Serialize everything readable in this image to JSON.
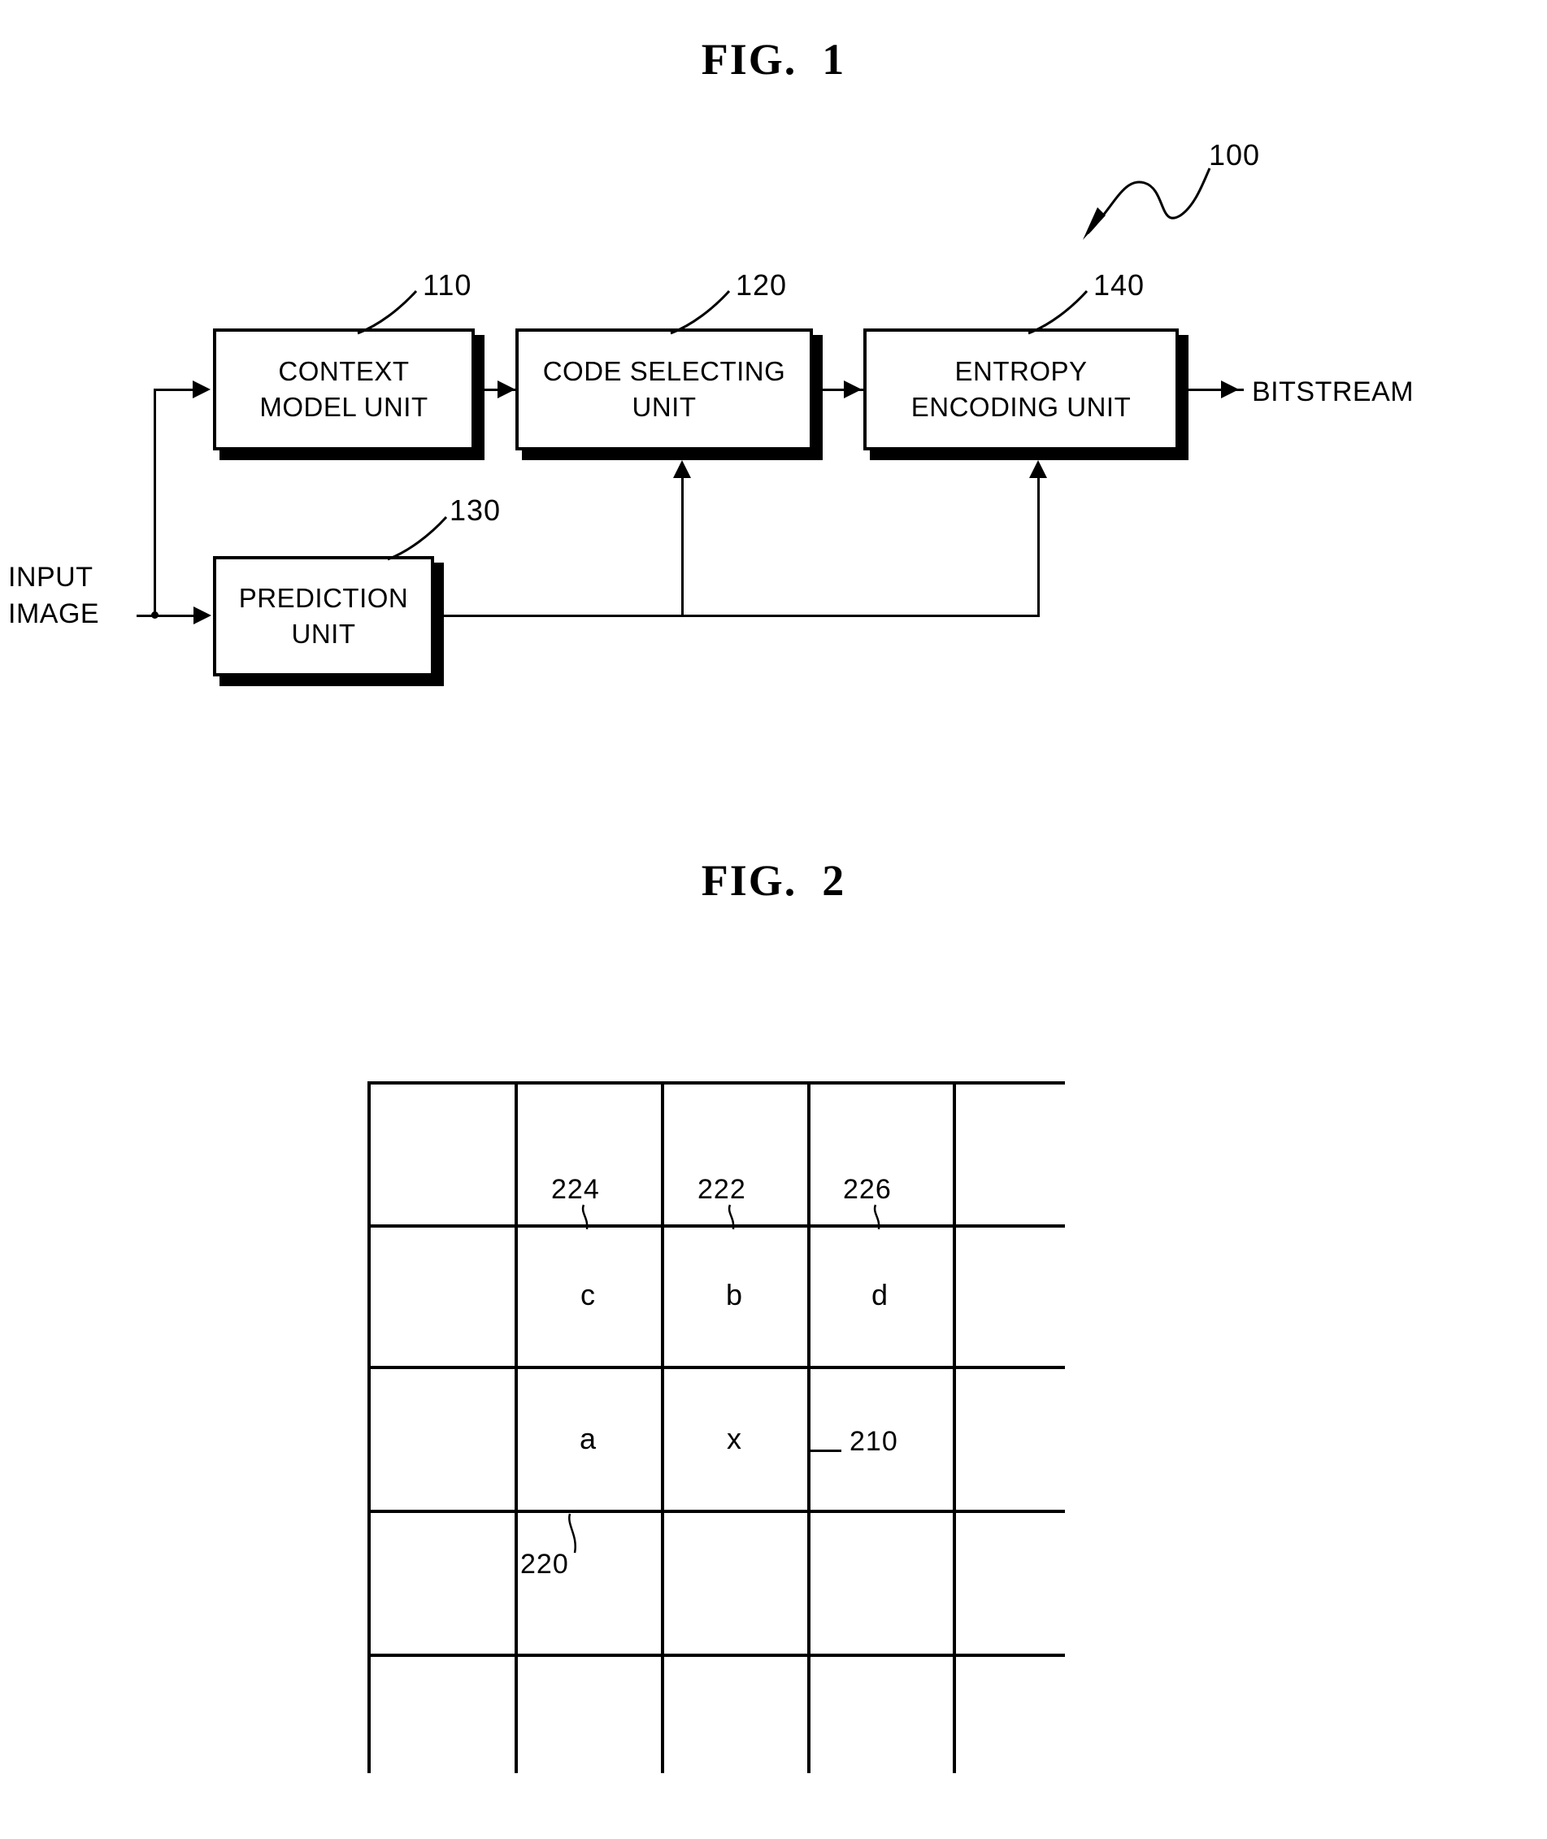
{
  "document": {
    "type": "patent-drawing-sheet",
    "background_color": "#ffffff",
    "line_color": "#000000"
  },
  "figure1": {
    "title": "FIG.  1",
    "system_ref": "100",
    "blocks": [
      {
        "id": "context-model-unit",
        "ref": "110",
        "label": "CONTEXT\nMODEL UNIT"
      },
      {
        "id": "code-selecting-unit",
        "ref": "120",
        "label": "CODE SELECTING\nUNIT"
      },
      {
        "id": "entropy-encoding-unit",
        "ref": "140",
        "label": "ENTROPY\nENCODING UNIT"
      },
      {
        "id": "prediction-unit",
        "ref": "130",
        "label": "PREDICTION\nUNIT"
      }
    ],
    "io_labels": {
      "input": "INPUT\nIMAGE",
      "output": "BITSTREAM"
    }
  },
  "figure2": {
    "title": "FIG.  2",
    "grid": {
      "columns": 5,
      "rows": 5,
      "cells": [
        [
          "",
          "",
          "",
          "",
          ""
        ],
        [
          "",
          "c",
          "b",
          "d",
          ""
        ],
        [
          "",
          "a",
          "x",
          "",
          ""
        ],
        [
          "",
          "",
          "",
          "",
          ""
        ],
        [
          "",
          "",
          "",
          "",
          ""
        ]
      ]
    },
    "refs": [
      {
        "ref": "224",
        "points_to": "c"
      },
      {
        "ref": "222",
        "points_to": "b"
      },
      {
        "ref": "226",
        "points_to": "d"
      },
      {
        "ref": "210",
        "points_to": "current-block"
      },
      {
        "ref": "220",
        "points_to": "a"
      }
    ]
  }
}
